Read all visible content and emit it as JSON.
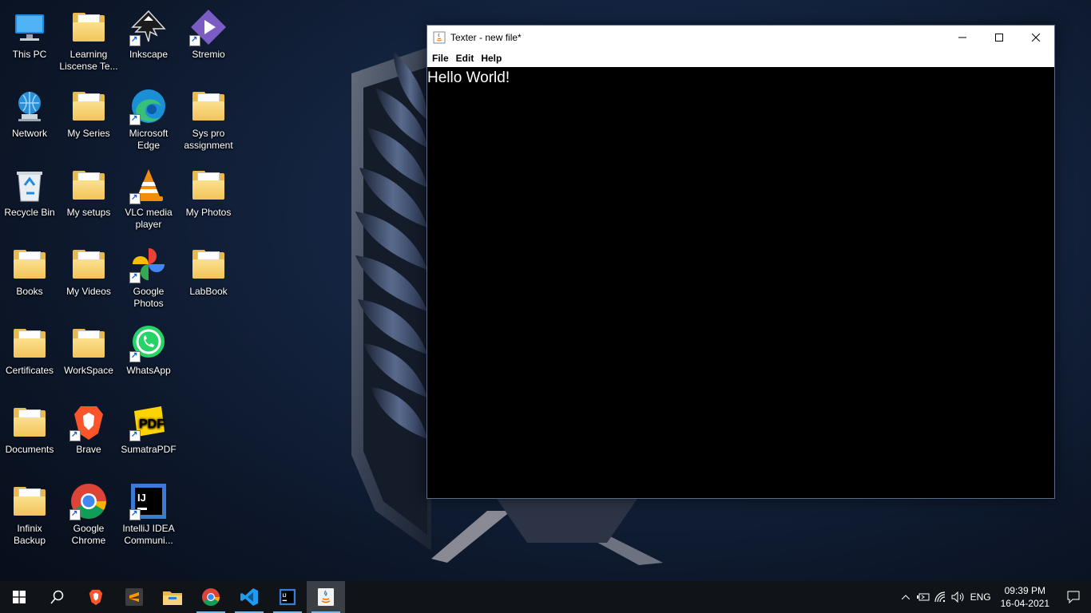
{
  "desktop": {
    "icons": [
      {
        "label": "This PC"
      },
      {
        "label": "Learning Liscense Te..."
      },
      {
        "label": "Inkscape"
      },
      {
        "label": "Stremio"
      },
      {
        "label": "Network"
      },
      {
        "label": "My Series"
      },
      {
        "label": "Microsoft Edge"
      },
      {
        "label": "Sys pro assignment"
      },
      {
        "label": "Recycle Bin"
      },
      {
        "label": "My setups"
      },
      {
        "label": "VLC media player"
      },
      {
        "label": "My Photos"
      },
      {
        "label": "Books"
      },
      {
        "label": "My Videos"
      },
      {
        "label": "Google Photos"
      },
      {
        "label": "LabBook"
      },
      {
        "label": "Certificates"
      },
      {
        "label": "WorkSpace"
      },
      {
        "label": "WhatsApp"
      },
      {
        "label": "Documents"
      },
      {
        "label": "Brave"
      },
      {
        "label": "SumatraPDF"
      },
      {
        "label": "Infinix Backup"
      },
      {
        "label": "Google Chrome"
      },
      {
        "label": "IntelliJ IDEA Communi..."
      }
    ]
  },
  "window": {
    "title": "Texter - new file*",
    "menu": [
      "File",
      "Edit",
      "Help"
    ],
    "content": "Hello World!"
  },
  "taskbar": {
    "apps": [
      "start-icon",
      "search-icon",
      "brave-icon",
      "sublime-text-icon",
      "file-explorer-icon",
      "chrome-icon",
      "vscode-icon",
      "intellij-icon",
      "java-icon"
    ],
    "language": "ENG",
    "time": "09:39 PM",
    "date": "16-04-2021"
  },
  "colors": {
    "folder": "#e8b94c",
    "taskbar": "#101418",
    "accent": "#76b9ed"
  }
}
